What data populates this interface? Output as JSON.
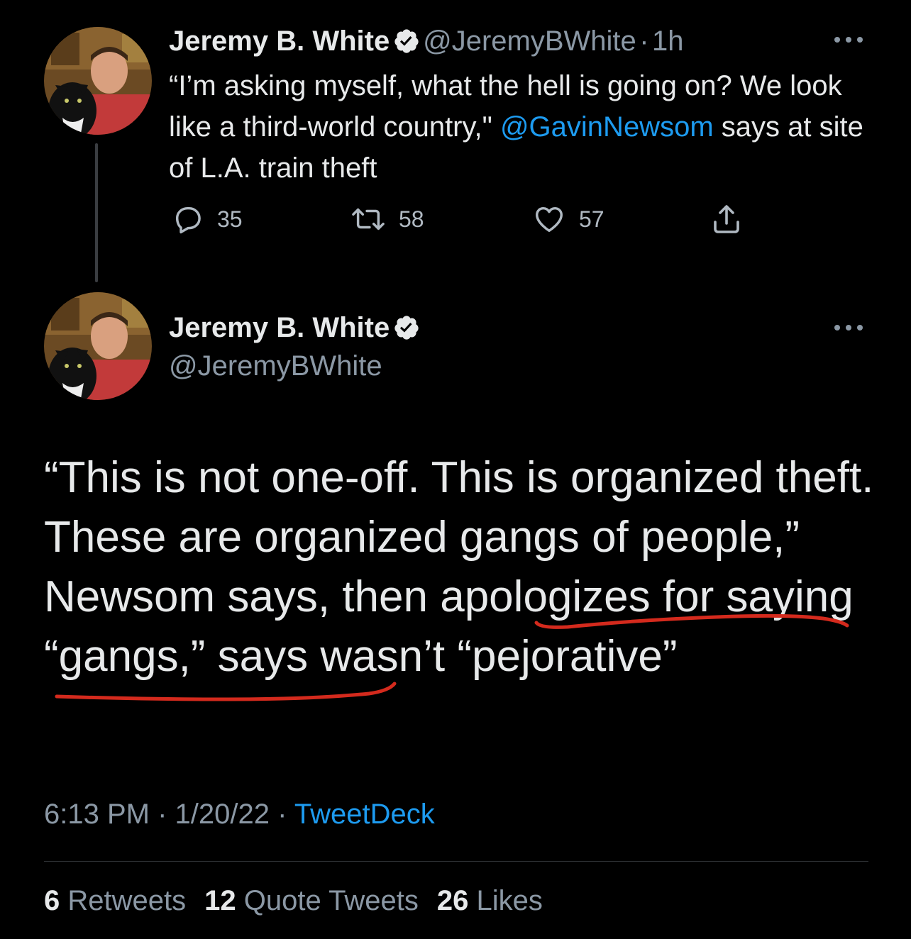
{
  "colors": {
    "background": "#000000",
    "text": "#e7e9ea",
    "muted": "#8b98a5",
    "link": "#1d9bf0",
    "annotation": "#d42a1d"
  },
  "tweet1": {
    "author_name": "Jeremy B. White",
    "handle": "@JeremyBWhite",
    "separator": "·",
    "time_ago": "1h",
    "text_before": "“I’m asking myself, what the hell is going on? We look like a third-world country,\" ",
    "mention": "@GavinNewsom",
    "text_after": " says at site of L.A. train theft",
    "replies": "35",
    "retweets": "58",
    "likes": "57",
    "icons": {
      "verified": "verified-badge-icon",
      "more": "more-options-icon",
      "reply": "reply-icon",
      "retweet": "retweet-icon",
      "like": "heart-icon",
      "share": "share-icon"
    }
  },
  "tweet2": {
    "author_name": "Jeremy B. White",
    "handle": "@JeremyBWhite",
    "text_part1": "“This is not one-off. This is organized theft. These are organized gangs of people,” Newsom says, ",
    "text_underlined1": "then apologizes",
    "text_part2": " ",
    "text_underlined2": "for saying “gangs,”",
    "text_part3": " says wasn’t “pejorative”",
    "time": "6:13 PM",
    "separator": "·",
    "date": "1/20/22",
    "source": "TweetDeck",
    "stats": {
      "retweets_count": "6",
      "retweets_label": "Retweets",
      "quote_count": "12",
      "quote_label": "Quote Tweets",
      "likes_count": "26",
      "likes_label": "Likes"
    }
  }
}
